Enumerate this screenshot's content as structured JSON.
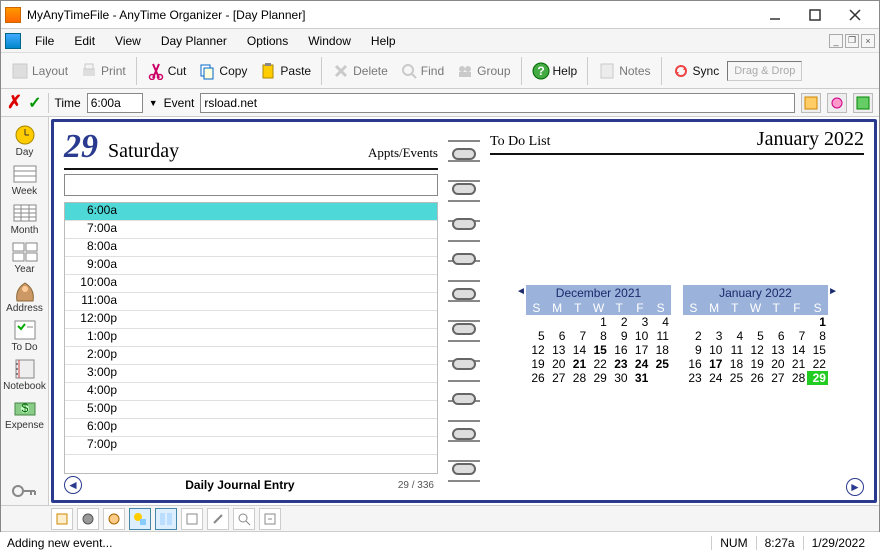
{
  "window": {
    "title": "MyAnyTimeFile - AnyTime Organizer - [Day Planner]"
  },
  "menu": {
    "items": [
      "File",
      "Edit",
      "View",
      "Day Planner",
      "Options",
      "Window",
      "Help"
    ]
  },
  "toolbar": {
    "items": [
      {
        "label": "Layout",
        "enabled": false,
        "icon": "layout-icon"
      },
      {
        "label": "Print",
        "enabled": false,
        "icon": "print-icon"
      },
      {
        "label": "Cut",
        "enabled": true,
        "icon": "cut-icon"
      },
      {
        "label": "Copy",
        "enabled": true,
        "icon": "copy-icon"
      },
      {
        "label": "Paste",
        "enabled": true,
        "icon": "paste-icon"
      },
      {
        "label": "Delete",
        "enabled": false,
        "icon": "delete-icon"
      },
      {
        "label": "Find",
        "enabled": false,
        "icon": "find-icon"
      },
      {
        "label": "Group",
        "enabled": false,
        "icon": "group-icon"
      },
      {
        "label": "Help",
        "enabled": true,
        "icon": "help-icon"
      },
      {
        "label": "Notes",
        "enabled": false,
        "icon": "notes-icon"
      },
      {
        "label": "Sync",
        "enabled": true,
        "icon": "sync-icon"
      }
    ],
    "dragdrop": "Drag & Drop"
  },
  "eventbar": {
    "time_label": "Time",
    "time_value": "6:00a",
    "event_label": "Event",
    "event_value": "rsload.net"
  },
  "sidebar": {
    "items": [
      {
        "label": "Day",
        "icon": "day-icon"
      },
      {
        "label": "Week",
        "icon": "week-icon"
      },
      {
        "label": "Month",
        "icon": "month-icon"
      },
      {
        "label": "Year",
        "icon": "year-icon"
      },
      {
        "label": "Address",
        "icon": "address-icon"
      },
      {
        "label": "To Do",
        "icon": "todo-icon"
      },
      {
        "label": "Notebook",
        "icon": "notebook-icon"
      },
      {
        "label": "Expense",
        "icon": "expense-icon"
      }
    ]
  },
  "planner": {
    "day_number": "29",
    "day_name": "Saturday",
    "appts_label": "Appts/Events",
    "todo_label": "To Do List",
    "month_year": "January 2022",
    "timeslots": [
      "6:00a",
      "7:00a",
      "8:00a",
      "9:00a",
      "10:00a",
      "11:00a",
      "12:00p",
      "1:00p",
      "2:00p",
      "3:00p",
      "4:00p",
      "5:00p",
      "6:00p",
      "7:00p"
    ],
    "selected_slot": 0,
    "journal_label": "Daily Journal Entry",
    "page_counter": "29 / 336"
  },
  "minicals": [
    {
      "title": "December 2021",
      "nav": "left",
      "dow": [
        "S",
        "M",
        "T",
        "W",
        "T",
        "F",
        "S"
      ],
      "weeks": [
        [
          "",
          "",
          "",
          "1",
          "2",
          "3",
          "4"
        ],
        [
          "5",
          "6",
          "7",
          "8",
          "9",
          "10",
          "11"
        ],
        [
          "12",
          "13",
          "14",
          "15",
          "16",
          "17",
          "18"
        ],
        [
          "19",
          "20",
          "21",
          "22",
          "23",
          "24",
          "25"
        ],
        [
          "26",
          "27",
          "28",
          "29",
          "30",
          "31",
          ""
        ]
      ],
      "bold": [
        "15",
        "21",
        "23",
        "24",
        "25",
        "31"
      ]
    },
    {
      "title": "January 2022",
      "nav": "right",
      "dow": [
        "S",
        "M",
        "T",
        "W",
        "T",
        "F",
        "S"
      ],
      "weeks": [
        [
          "",
          "",
          "",
          "",
          "",
          "",
          "1"
        ],
        [
          "2",
          "3",
          "4",
          "5",
          "6",
          "7",
          "8"
        ],
        [
          "9",
          "10",
          "11",
          "12",
          "13",
          "14",
          "15"
        ],
        [
          "16",
          "17",
          "18",
          "19",
          "20",
          "21",
          "22"
        ],
        [
          "23",
          "24",
          "25",
          "26",
          "27",
          "28",
          "29"
        ]
      ],
      "bold": [
        "1",
        "17"
      ],
      "today": "29"
    }
  ],
  "statusbar": {
    "text": "Adding new event...",
    "num": "NUM",
    "time": "8:27a",
    "date": "1/29/2022"
  }
}
